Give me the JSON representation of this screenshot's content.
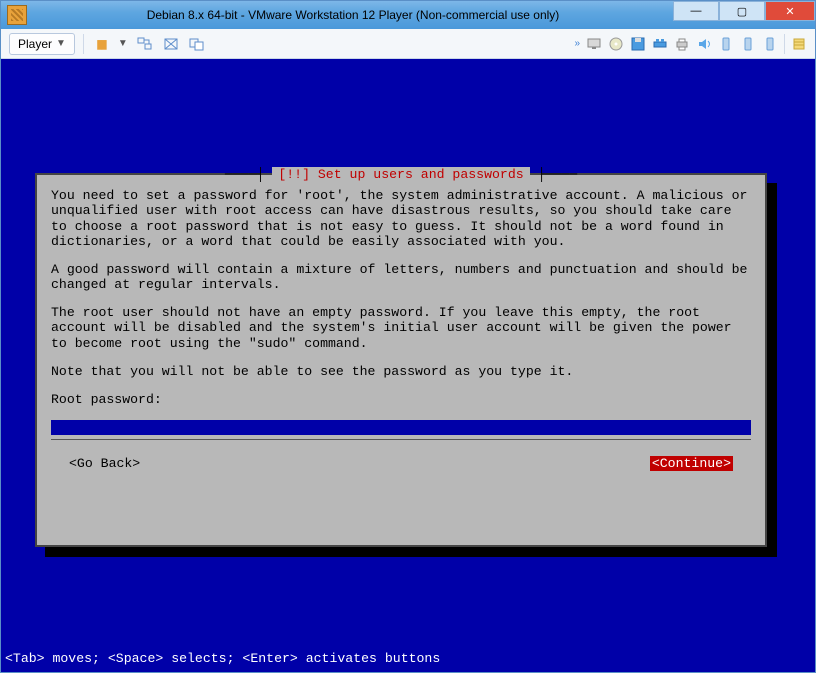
{
  "window": {
    "title": "Debian 8.x 64-bit - VMware Workstation 12 Player (Non-commercial use only)",
    "controls": {
      "minimize": "—",
      "maximize": "▢",
      "close": "✕"
    }
  },
  "toolbar": {
    "player_label": "Player",
    "icons": {
      "pause": "pause-icon",
      "send_cad": "send-ctrl-alt-del-icon",
      "fullscreen": "fullscreen-icon",
      "unity": "unity-icon"
    }
  },
  "toolbar_right_icons": [
    "network-icon",
    "cdrom-icon",
    "floppy-icon",
    "usb-hub-icon",
    "printer-icon",
    "sound-icon",
    "drive1-icon",
    "drive2-icon",
    "drive3-icon",
    "settings-icon"
  ],
  "installer": {
    "title": "[!!] Set up users and passwords",
    "para1": "You need to set a password for 'root', the system administrative account. A malicious or unqualified user with root access can have disastrous results, so you should take care to choose a root password that is not easy to guess. It should not be a word found in dictionaries, or a word that could be easily associated with you.",
    "para2": "A good password will contain a mixture of letters, numbers and punctuation and should be changed at regular intervals.",
    "para3": "The root user should not have an empty password. If you leave this empty, the root account will be disabled and the system's initial user account will be given the power to become root using the \"sudo\" command.",
    "para4": "Note that you will not be able to see the password as you type it.",
    "prompt": "Root password:",
    "password_value": "",
    "go_back": "<Go Back>",
    "continue": "<Continue>"
  },
  "footer_hint": "<Tab> moves; <Space> selects; <Enter> activates buttons"
}
